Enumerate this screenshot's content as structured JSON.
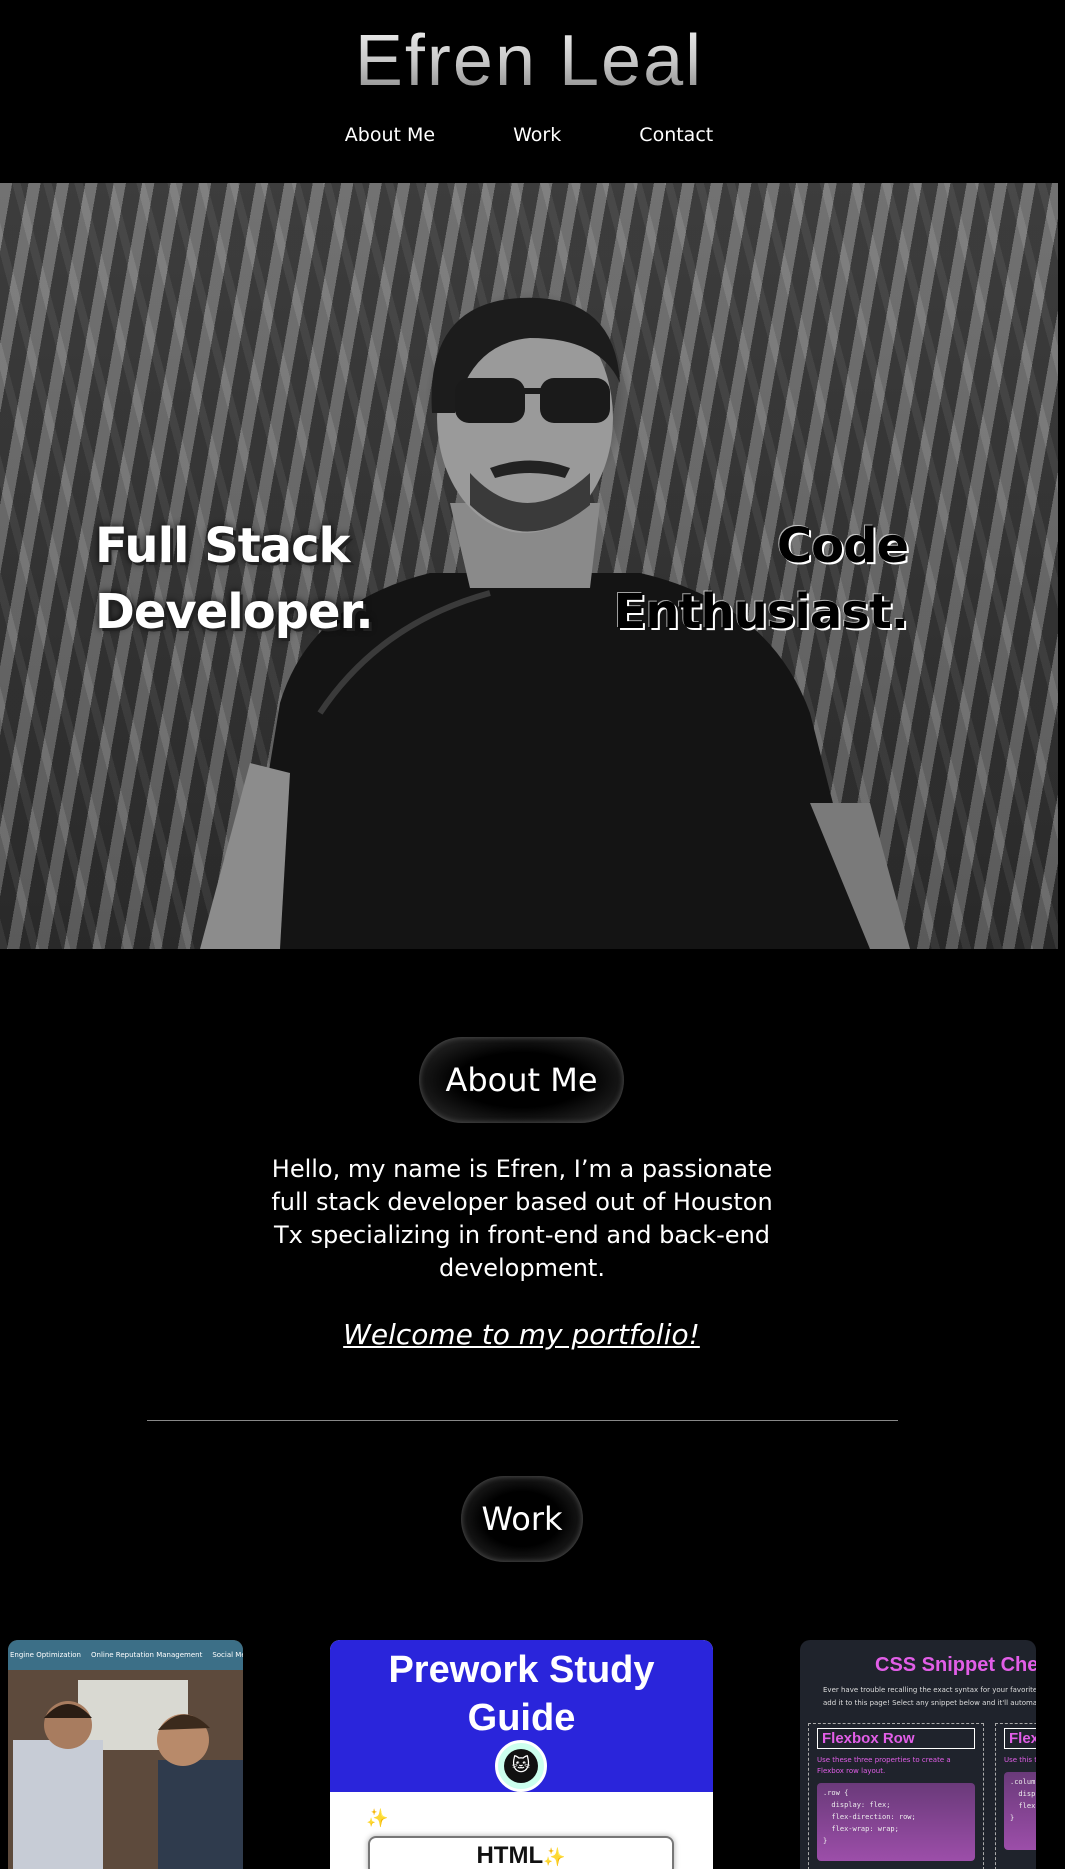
{
  "header": {
    "title": "Efren Leal",
    "nav": [
      {
        "label": "About Me"
      },
      {
        "label": "Work"
      },
      {
        "label": "Contact"
      }
    ]
  },
  "hero": {
    "left_line1": "Full Stack",
    "left_line2": "Developer.",
    "right_line1": "Code",
    "right_line2": "Enthusiast."
  },
  "about": {
    "heading": "About Me",
    "text": "Hello, my name is Efren, I’m a passionate full stack developer based out of Houston Tx specializing in front-end and back-end development.",
    "welcome": "Welcome to my portfolio!"
  },
  "work": {
    "heading": "Work",
    "cards": [
      {
        "nav_items": [
          "Engine Optimization",
          "Online Reputation Management",
          "Social Media Marketing"
        ]
      },
      {
        "title": "Prework Study Guide",
        "section": "HTML",
        "spark": "✨"
      },
      {
        "title": "CSS Snippet Chea",
        "subtitle_line1": "Ever have trouble recalling the exact syntax for your favorite CSS c",
        "subtitle_line2": "add it to this page! Select any snippet below and it'll automatically",
        "panel1_title": "Flexbox Row",
        "panel1_desc": "Use these three properties to create a Flexbox row layout.",
        "panel1_code": ".row {\n  display: flex;\n  flex-direction: row;\n  flex-wrap: wrap;\n}",
        "panel2_title": "Flex",
        "panel2_desc": "Use this t",
        "panel2_code": ".colum\n  disp\n  flex\n}"
      }
    ]
  },
  "colors": {
    "background": "#000000",
    "card_blue": "#2a25db",
    "snippet_pink": "#e25ee8"
  }
}
